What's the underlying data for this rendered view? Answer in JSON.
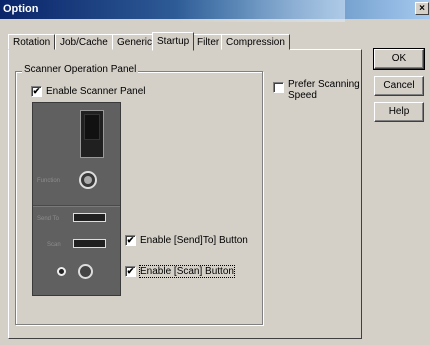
{
  "window": {
    "title": "Option",
    "close_glyph": "×"
  },
  "tabs": [
    {
      "label": "Rotation"
    },
    {
      "label": "Job/Cache"
    },
    {
      "label": "Generic"
    },
    {
      "label": "Startup",
      "active": true
    },
    {
      "label": "Filter"
    },
    {
      "label": "Compression"
    }
  ],
  "startup": {
    "group_title": "Scanner Operation Panel",
    "enable_scanner_panel": {
      "label": "Enable Scanner Panel",
      "checked": true,
      "mark": "✔"
    },
    "prefer_scanning_speed": {
      "label_line1": "Prefer Scanning",
      "label_line2": "Speed",
      "checked": false,
      "mark": ""
    },
    "enable_sendto_button": {
      "label": "Enable [Send]To] Button",
      "checked": true,
      "mark": "✔"
    },
    "enable_scan_button": {
      "label": "Enable [Scan] Button",
      "checked": true,
      "mark": "✔"
    }
  },
  "scanner_panel": {
    "function_label": "Function",
    "sendto_label": "Send To",
    "scan_label": "Scan"
  },
  "buttons": {
    "ok": "OK",
    "cancel": "Cancel",
    "help": "Help"
  }
}
